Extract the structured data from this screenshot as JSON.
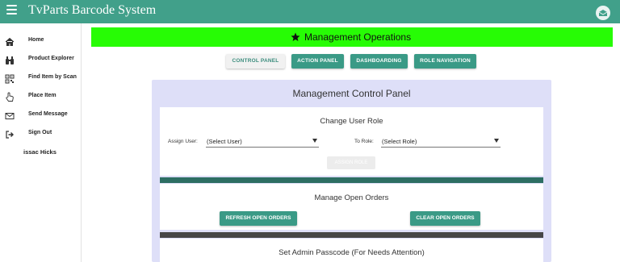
{
  "header": {
    "title": "TvParts Barcode System",
    "menu_icon": "hamburger-icon",
    "mail_icon": "envelope-open-icon",
    "color": "#41a08a"
  },
  "sidebar": {
    "items": [
      {
        "label": "Home",
        "icon": "home-icon"
      },
      {
        "label": "Product Explorer",
        "icon": "binoculars-icon"
      },
      {
        "label": "Find Item by Scan",
        "icon": "qr-code-icon"
      },
      {
        "label": "Place Item",
        "icon": "hand-pointer-icon"
      },
      {
        "label": "Send Message",
        "icon": "envelope-icon"
      },
      {
        "label": "Sign Out",
        "icon": "sign-out-icon"
      }
    ],
    "user_name": "issac Hicks"
  },
  "banner": {
    "text": "Management Operations",
    "icon": "star-icon",
    "color": "#27fc05"
  },
  "tabs": [
    {
      "label": "CONTROL PANEL",
      "active": true
    },
    {
      "label": "ACTION PANEL",
      "active": false
    },
    {
      "label": "DASHBOARDING",
      "active": false
    },
    {
      "label": "ROLE NAVIGATION",
      "active": false
    }
  ],
  "panel": {
    "title": "Management Control Panel",
    "color": "#dedff8",
    "change_role": {
      "heading": "Change User Role",
      "assign_user_label": "Assign User:",
      "assign_user_value": "(Select User)",
      "to_role_label": "To Role:",
      "to_role_value": "(Select Role)",
      "assign_button": "ASSIGN ROLE"
    },
    "open_orders": {
      "heading": "Manage Open Orders",
      "refresh_button": "REFRESH OPEN ORDERS",
      "clear_button": "CLEAR OPEN ORDERS"
    },
    "passcode": {
      "heading": "Set Admin Passcode (For Needs Attention)"
    }
  }
}
